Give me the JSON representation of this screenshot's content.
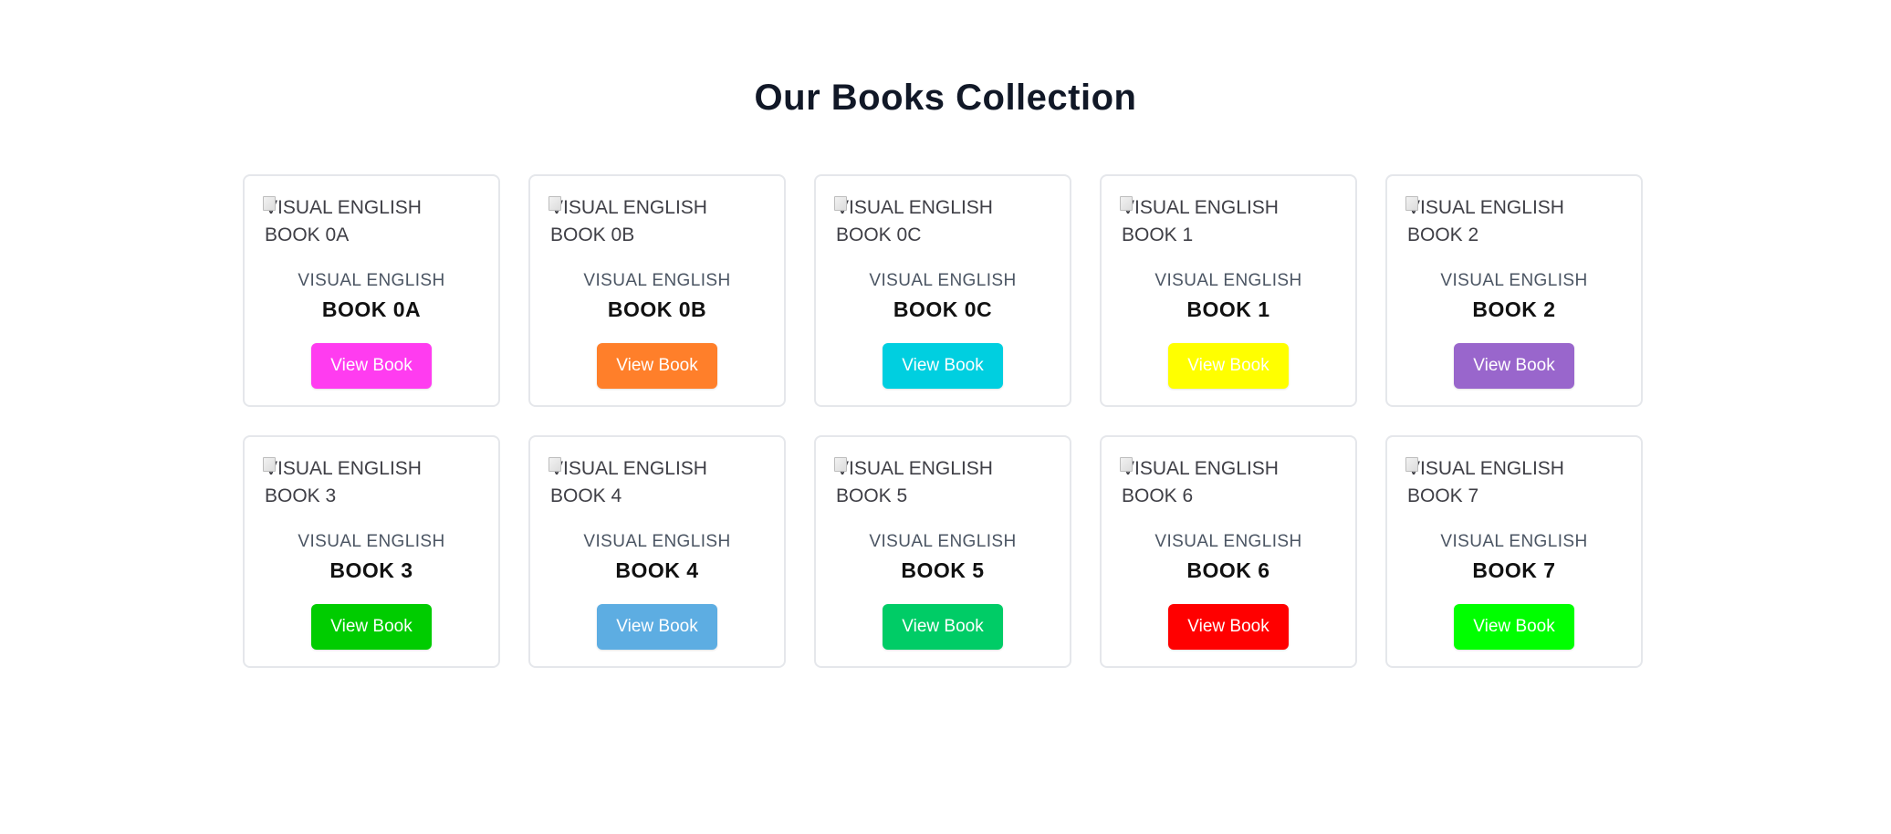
{
  "page": {
    "title": "Our Books Collection"
  },
  "books": [
    {
      "alt_line1": "VISUAL ENGLISH",
      "alt_line2": "BOOK 0A",
      "series": "VISUAL ENGLISH",
      "name": "BOOK 0A",
      "button_label": "View Book",
      "button_color": "#ff3cf0"
    },
    {
      "alt_line1": "VISUAL ENGLISH",
      "alt_line2": "BOOK 0B",
      "series": "VISUAL ENGLISH",
      "name": "BOOK 0B",
      "button_label": "View Book",
      "button_color": "#ff7f2a"
    },
    {
      "alt_line1": "VISUAL ENGLISH",
      "alt_line2": "BOOK 0C",
      "series": "VISUAL ENGLISH",
      "name": "BOOK 0C",
      "button_label": "View Book",
      "button_color": "#00cfe0"
    },
    {
      "alt_line1": "VISUAL ENGLISH",
      "alt_line2": "BOOK 1",
      "series": "VISUAL ENGLISH",
      "name": "BOOK 1",
      "button_label": "View Book",
      "button_color": "#ffff00"
    },
    {
      "alt_line1": "VISUAL ENGLISH",
      "alt_line2": "BOOK 2",
      "series": "VISUAL ENGLISH",
      "name": "BOOK 2",
      "button_label": "View Book",
      "button_color": "#9966cc"
    },
    {
      "alt_line1": "VISUAL ENGLISH",
      "alt_line2": "BOOK 3",
      "series": "VISUAL ENGLISH",
      "name": "BOOK 3",
      "button_label": "View Book",
      "button_color": "#00cc00"
    },
    {
      "alt_line1": "VISUAL ENGLISH",
      "alt_line2": "BOOK 4",
      "series": "VISUAL ENGLISH",
      "name": "BOOK 4",
      "button_label": "View Book",
      "button_color": "#5dade2"
    },
    {
      "alt_line1": "VISUAL ENGLISH",
      "alt_line2": "BOOK 5",
      "series": "VISUAL ENGLISH",
      "name": "BOOK 5",
      "button_label": "View Book",
      "button_color": "#00cc66"
    },
    {
      "alt_line1": "VISUAL ENGLISH",
      "alt_line2": "BOOK 6",
      "series": "VISUAL ENGLISH",
      "name": "BOOK 6",
      "button_label": "View Book",
      "button_color": "#ff0000"
    },
    {
      "alt_line1": "VISUAL ENGLISH",
      "alt_line2": "BOOK 7",
      "series": "VISUAL ENGLISH",
      "name": "BOOK 7",
      "button_label": "View Book",
      "button_color": "#00ff00"
    }
  ]
}
